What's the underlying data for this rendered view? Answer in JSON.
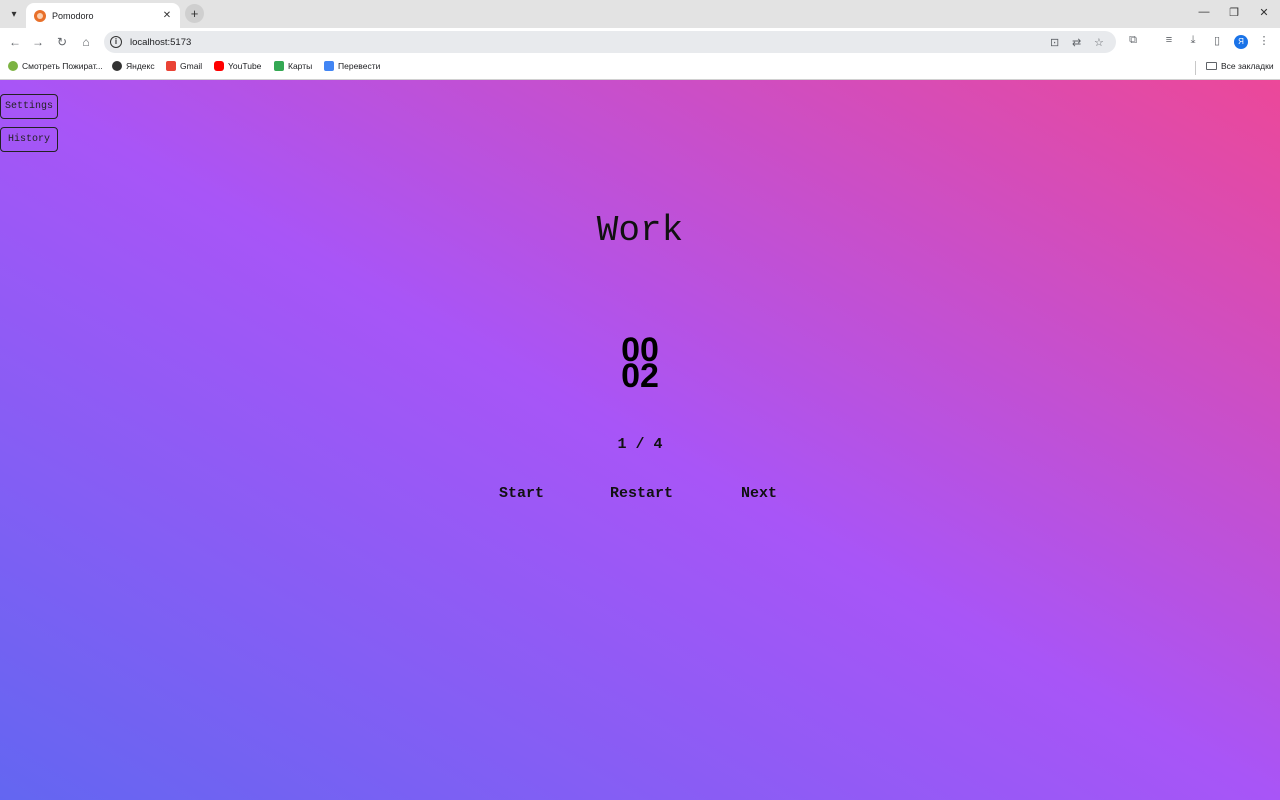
{
  "browser": {
    "tab_title": "Pomodoro",
    "url": "localhost:5173",
    "bookmarks": [
      {
        "label": "Смотреть Пожират...",
        "color": "#7cb342"
      },
      {
        "label": "Яндекс",
        "color": "#333333"
      },
      {
        "label": "Gmail",
        "color": "#ea4335"
      },
      {
        "label": "YouTube",
        "color": "#ff0000"
      },
      {
        "label": "Карты",
        "color": "#34a853"
      },
      {
        "label": "Перевести",
        "color": "#4285f4"
      }
    ],
    "all_bookmarks_label": "Все закладки",
    "profile_initial": "Я"
  },
  "app": {
    "settings_label": "Settings",
    "history_label": "History",
    "mode_title": "Work",
    "timer": {
      "minutes": "00",
      "seconds": "02"
    },
    "round": "1 / 4",
    "buttons": {
      "start": "Start",
      "restart": "Restart",
      "next": "Next"
    },
    "gradient": {
      "from": "#6366f1",
      "via": "#a855f7",
      "to": "#ec4899"
    }
  }
}
